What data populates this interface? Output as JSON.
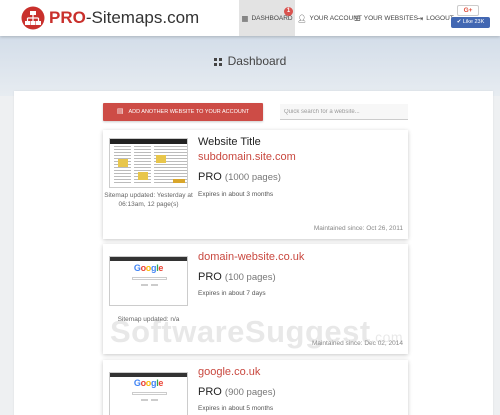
{
  "header": {
    "brand_pro": "PRO",
    "brand_rest": "-Sitemaps.com",
    "nav": {
      "dashboard": "DASHBOARD",
      "dashboard_badge": "1",
      "account": "YOUR ACCOUNT",
      "websites": "YOUR WEBSITES",
      "logout": "LOGOUT"
    },
    "gplus_label": "G+",
    "fb_like_label": "Like 23K"
  },
  "hero": {
    "title": "Dashboard"
  },
  "toolbar": {
    "add_label": "ADD ANOTHER WEBSITE TO YOUR ACCOUNT",
    "search_placeholder": "Quick search for a website..."
  },
  "websites": [
    {
      "title": "Website Title",
      "domain": "subdomain.site.com",
      "plan": "PRO",
      "pages": "(1000 pages)",
      "expires": "Expires in about 3 months",
      "sitemap_status": "Sitemap updated: Yesterday at 06:13am, 12 page(s)",
      "maintained": "Maintained since: Oct 26, 2011"
    },
    {
      "domain": "domain-website.co.uk",
      "plan": "PRO",
      "pages": "(100 pages)",
      "expires": "Expires in about 7 days",
      "sitemap_status": "Sitemap updated: n/a",
      "maintained": "Maintained since: Dec 02, 2014"
    },
    {
      "domain": "google.co.uk",
      "plan": "PRO",
      "pages": "(900 pages)",
      "expires": "Expires in about 5 months"
    }
  ],
  "thumbnail_text": {
    "google_logo": [
      "G",
      "o",
      "o",
      "g",
      "l",
      "e"
    ]
  },
  "watermark": {
    "text": "SoftwareSuggest",
    "suffix": ".com"
  },
  "colors": {
    "brand_red": "#c9302c",
    "button_red": "#cd4c46",
    "domain_red": "#c9483f",
    "fb_blue": "#4267b2"
  },
  "icons": {
    "logo": "sitemap-logo-icon",
    "dashboard": "grid-icon",
    "account": "user-icon",
    "websites": "list-icon",
    "logout": "logout-icon",
    "add": "add-site-icon"
  }
}
